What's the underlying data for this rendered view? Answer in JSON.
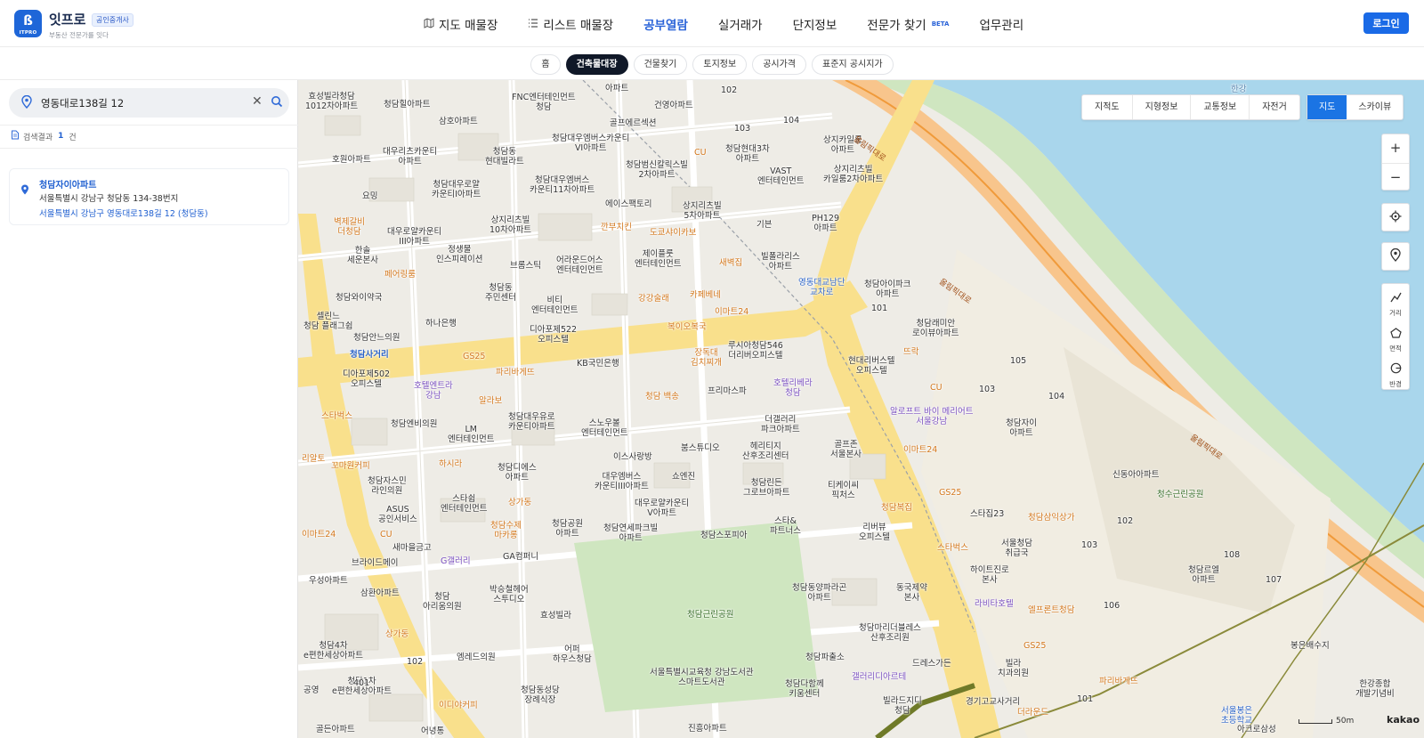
{
  "header": {
    "logo_glyph": "ß",
    "logo_sub": "ITPRO",
    "brand": "잇프로",
    "agent_badge": "공인중개사",
    "tagline": "부동산 전문가를 잇다",
    "nav": [
      {
        "label": "지도 매물장",
        "icon": "map-icon"
      },
      {
        "label": "리스트 매물장",
        "icon": "list-icon"
      },
      {
        "label": "공부열람",
        "active": true
      },
      {
        "label": "실거래가"
      },
      {
        "label": "단지정보"
      },
      {
        "label": "전문가 찾기",
        "badge": "BETA"
      },
      {
        "label": "업무관리"
      }
    ],
    "login": "로그인"
  },
  "subtabs": [
    "홈",
    "건축물대장",
    "건물찾기",
    "토지정보",
    "공시가격",
    "표준지 공시지가"
  ],
  "subtab_active": 1,
  "sidebar": {
    "search_value": "영동대로138길 12",
    "result_label": "검색결과",
    "result_count": "1",
    "result_unit": "건",
    "result": {
      "name": "청담자이아파트",
      "jibun": "서울특별시 강남구 청담동 134-38번지",
      "road": "서울특별시 강남구 영동대로138길 12 (청담동)"
    }
  },
  "map": {
    "tools": [
      "지적도",
      "지형정보",
      "교통정보",
      "자전거"
    ],
    "types": [
      "지도",
      "스카이뷰"
    ],
    "zoom_in": "+",
    "zoom_out": "−",
    "measure": [
      "거리",
      "면적",
      "반경"
    ],
    "scale": "50m",
    "provider": "kakao",
    "river_label": "한강",
    "road_labels": [
      "올림픽대로",
      "올림픽대로",
      "올림픽대로"
    ],
    "place_labels": [
      "효성빌라청담\n1012차아파트",
      "청담힐아파트",
      "FNC엔터테인먼트\n청담",
      "아파트",
      "건영아파트",
      "102",
      "삼호아파트",
      "골프에르섹션",
      "103",
      "104",
      "청담대우엠버스카운티\nVI아파트",
      "상지카일룸\n아파트",
      "호원아파트",
      "대우리츠카운티\n아파트",
      "청담동\n현대빌라트",
      "CU",
      "청담현대3차\n아파트",
      "청담범신칼릭스빌\n2차아파트",
      "VAST\n엔터테인먼트",
      "상지리츠빌\n카일룸2차아파트",
      "요밍",
      "청담대우로얄\n카운티I아파트",
      "청담대우엠버스\n카운티11차아파트",
      "에이스팩토리",
      "상지리츠빌\n5차아파트",
      "벽제갈비\n더청담",
      "대우로얄카운티\nIII아파트",
      "상지리츠빌\n10차아파트",
      "깐부치킨",
      "도쿄샤이카보",
      "기븐",
      "PH129\n아파트",
      "한솔\n세운본사",
      "정생물\n인스피레이션",
      "제이플룻\n엔터테인먼트",
      "새벽집",
      "빌폴라리스\n아파트",
      "페어링룸",
      "브롬스틱",
      "어라운드어스\n엔터테인먼트",
      "청담동\n주민센터",
      "청담와이약국",
      "비티\n엔터테인먼트",
      "강강술래",
      "카페베네",
      "영동대교남단\n교차로",
      "청담아이파크\n아파트",
      "101",
      "하나은행",
      "셀린느\n청담 플래그쉽",
      "디아포제522\n오피스텔",
      "이마트24",
      "복이오복국",
      "청담래미안\n로이뷰아파트",
      "청담안느의원",
      "청담사거리",
      "루시아청담546\n더리버오피스텔",
      "GS25",
      "KB국민은행",
      "장독대\n김치찌개",
      "현대리버스텔\n오피스텔",
      "뜨락",
      "디아포제502\n오피스텔",
      "파리바게뜨",
      "호텔엔트라\n강남",
      "청담 백송",
      "프리마스파",
      "호텔리베라\n청담",
      "CU",
      "105",
      "103",
      "104",
      "알라보",
      "스타벅스",
      "알로프트 바이 메리어트\n서울강남",
      "청담자이\n아파트",
      "청담엔비의원",
      "LM\n엔터테인먼트",
      "청담대우유로\n카운티아파트",
      "스노우볼\n엔터테인먼트",
      "더갤러리\n파크아파트",
      "헤리티지\n산후조리센터",
      "골프존\n서울본사",
      "이마트24",
      "리알토",
      "꼬마원커피",
      "하시라",
      "청담디에스\n아파트",
      "이스사랑방",
      "붐스튜디오",
      "신동아아파트",
      "청수근린공원",
      "청담자스민\n라인의원",
      "스타쉽\n엔터테인먼트",
      "대우엠버스\n카운티III아파트",
      "쇼엔진",
      "티케이씨\n픽처스",
      "청담린든\n그로브아파트",
      "GS25",
      "ASUS\n공인서비스",
      "상가동",
      "대우로얄카운티\nV아파트",
      "청담복집",
      "스타집23",
      "청담삼익상가",
      "CU",
      "청담수제\n마카롱",
      "청담공원\n아파트",
      "청담연세파크빌\n아파트",
      "스타&\n파트너스",
      "리버뷰\n오피스텔",
      "스타벅스",
      "서울청담\n취급국",
      "102",
      "103",
      "이마트24",
      "새마을금고",
      "G갤러리",
      "GA컴퍼니",
      "청담스포피아",
      "108",
      "하이트진로\n본사",
      "청담르엘\n아파트",
      "107",
      "브라이드메이",
      "우성아파트",
      "삼환아파트",
      "청담\n아리움의원",
      "박승철헤어\n스투디오",
      "청담동양파라곤\n아파트",
      "동국제약\n본사",
      "라비타호텔",
      "엘프론트청담",
      "106",
      "효성빌라",
      "청담근린공원",
      "청담마리더블레스\n산후조리원",
      "GS25",
      "청담4차\ne편한세상아파트",
      "상가동",
      "엠레드의원",
      "어퍼\n하우스청담",
      "청담파출소",
      "드레스가든",
      "빌라\n치과의원",
      "봉은배수지",
      "서울특별시교육청 강남도서관\n스마트도서관",
      "청담다함께\n키움센터",
      "갤러리디아르테",
      "파리바게뜨",
      "청담1차\ne편한세상아파트",
      "청담동성당\n장례식장",
      "이디야커피",
      "빌라드지디\n청담",
      "경기고교사거리",
      "더라운드",
      "한강종합\n개발기념비",
      "서울봉은\n초등학교",
      "아크로삼성",
      "진흥아파트",
      "골든아파트",
      "어녕통",
      "101",
      "401",
      "102",
      "공영"
    ]
  }
}
